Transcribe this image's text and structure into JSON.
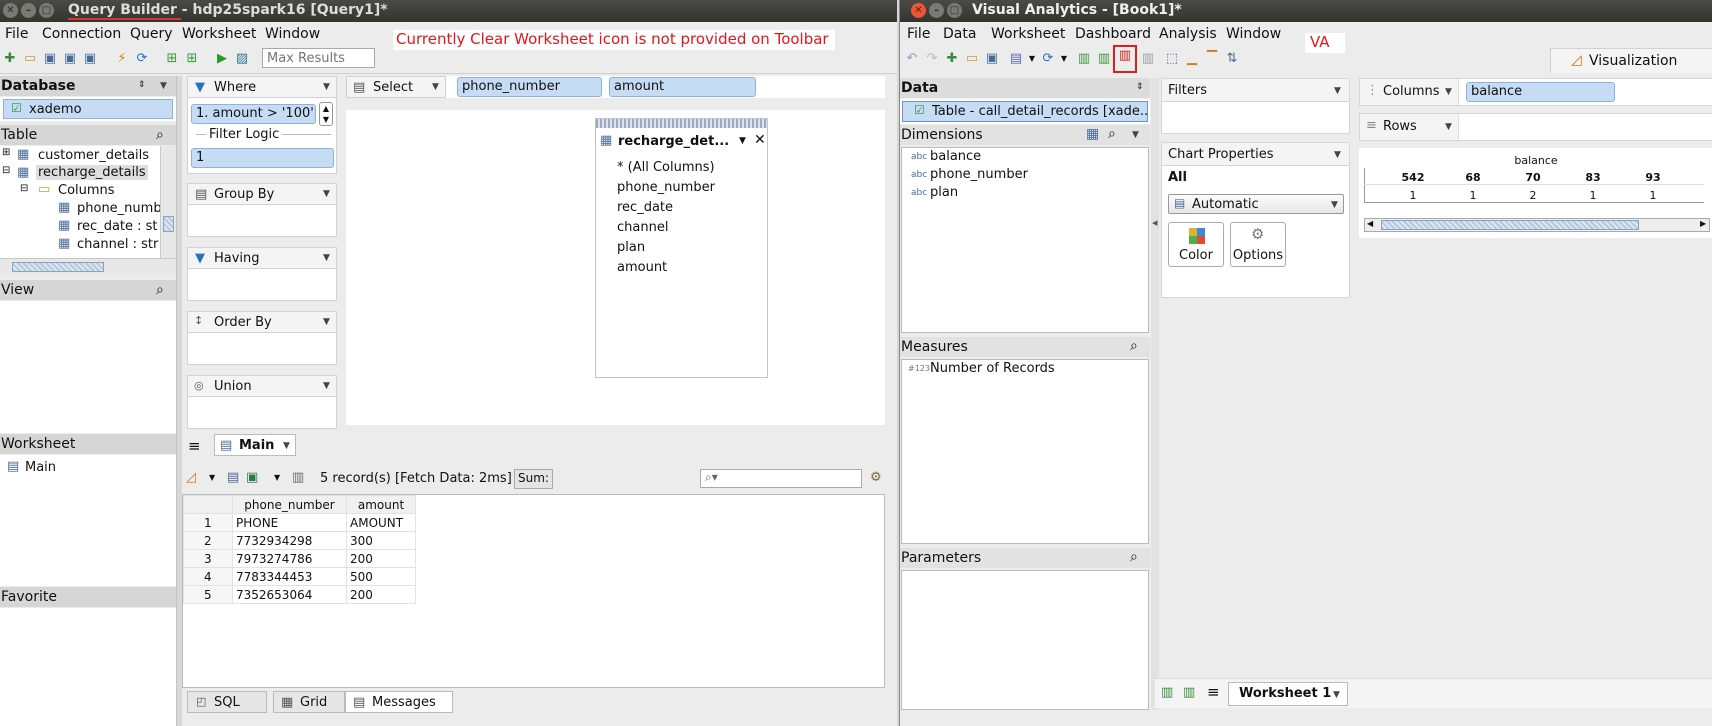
{
  "qb": {
    "window_title": "Query Builder - hdp25spark16 [Query1]*",
    "menu": [
      "File",
      "Connection",
      "Query",
      "Worksheet",
      "Window"
    ],
    "max_results_placeholder": "Max Results",
    "annotation": "Currently  Clear Worksheet icon is not provided on Toolbar",
    "database": {
      "header": "Database",
      "selected": "xademo"
    },
    "table_panel": {
      "header": "Table",
      "items": [
        "customer_details",
        "recharge_details",
        "Columns",
        "phone_numb",
        "rec_date : st",
        "channel : str"
      ]
    },
    "view_panel": {
      "header": "View"
    },
    "worksheet_panel": {
      "header": "Worksheet",
      "item": "Main"
    },
    "favorite_panel": {
      "header": "Favorite"
    },
    "where": {
      "label": "Where",
      "condition": "1. amount > '100'",
      "filter_logic_label": "Filter Logic",
      "filter_logic_value": "1"
    },
    "group_by": "Group By",
    "having": "Having",
    "order_by": "Order By",
    "union": "Union",
    "select": {
      "label": "Select",
      "columns": [
        "phone_number",
        "amount"
      ]
    },
    "table_box": {
      "title": "recharge_det...",
      "columns": [
        "* (All Columns)",
        "phone_number",
        "rec_date",
        "channel",
        "plan",
        "amount"
      ]
    },
    "main_tab": "Main",
    "results": {
      "status": "5 record(s) [Fetch Data: 2ms]",
      "sum_label": "Sum:",
      "headers": [
        "",
        "phone_number",
        "amount"
      ],
      "rows": [
        [
          "1",
          "PHONE",
          "AMOUNT"
        ],
        [
          "2",
          "7732934298",
          "300"
        ],
        [
          "3",
          "7973274786",
          "200"
        ],
        [
          "4",
          "7783344453",
          "500"
        ],
        [
          "5",
          "7352653064",
          "200"
        ]
      ]
    },
    "bottom_tabs": [
      "SQL",
      "Grid",
      "Messages"
    ]
  },
  "va": {
    "window_title": "Visual Analytics - [Book1]*",
    "menu": [
      "File",
      "Data",
      "Worksheet",
      "Dashboard",
      "Analysis",
      "Window"
    ],
    "annotation": "VA",
    "visualization_tab": "Visualization",
    "data_header": "Data",
    "table_source": "Table - call_detail_records [xade...",
    "dimensions_header": "Dimensions",
    "dimensions": [
      "balance",
      "phone_number",
      "plan"
    ],
    "dim_type_label": "abc",
    "measures_header": "Measures",
    "measures": [
      "Number of Records"
    ],
    "measure_type_label": "#123",
    "parameters_header": "Parameters",
    "filters_header": "Filters",
    "chart_props_header": "Chart Properties",
    "all_label": "All",
    "chart_type": "Automatic",
    "color_btn": "Color",
    "options_btn": "Options",
    "columns_label": "Columns",
    "columns_chip": "balance",
    "rows_label": "Rows",
    "crosstab": {
      "header": "balance",
      "columns": [
        "542",
        "68",
        "70",
        "83",
        "93"
      ],
      "values": [
        "1",
        "1",
        "2",
        "1",
        "1"
      ]
    },
    "worksheet_tab": "Worksheet 1"
  }
}
